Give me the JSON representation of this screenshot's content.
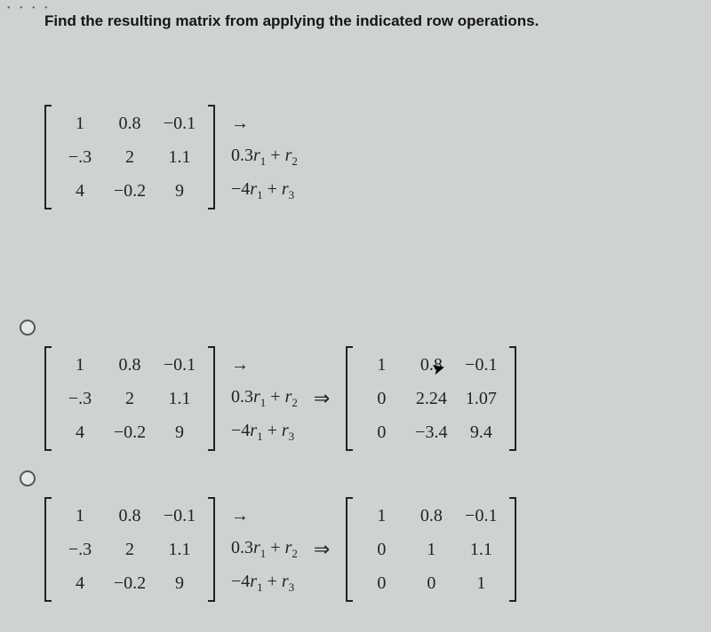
{
  "dots": "• • • •",
  "prompt": "Find the resulting matrix from applying the indicated row operations.",
  "matrix_original": {
    "r1": [
      "1",
      "0.8",
      "−0.1"
    ],
    "r2": [
      "−.3",
      "2",
      "1.1"
    ],
    "r3": [
      "4",
      "−0.2",
      "9"
    ]
  },
  "ops": {
    "line1": "→",
    "line2_pre": "0.3",
    "line2_r1": "r",
    "line2_r1s": "1",
    "line2_mid": " + ",
    "line2_r2": "r",
    "line2_r2s": "2",
    "line3_pre": "−4",
    "line3_r1": "r",
    "line3_r1s": "1",
    "line3_mid": " + ",
    "line3_r3": "r",
    "line3_r3s": "3"
  },
  "option_a_result": {
    "r1": [
      "1",
      "0.8",
      "−0.1"
    ],
    "r2": [
      "0",
      "2.24",
      "1.07"
    ],
    "r3": [
      "0",
      "−3.4",
      "9.4"
    ]
  },
  "option_b_result": {
    "r1": [
      "1",
      "0.8",
      "−0.1"
    ],
    "r2": [
      "0",
      "1",
      "1.1"
    ],
    "r3": [
      "0",
      "0",
      "1"
    ]
  },
  "implies_symbol": "⇒",
  "cursor_glyph": "➤"
}
